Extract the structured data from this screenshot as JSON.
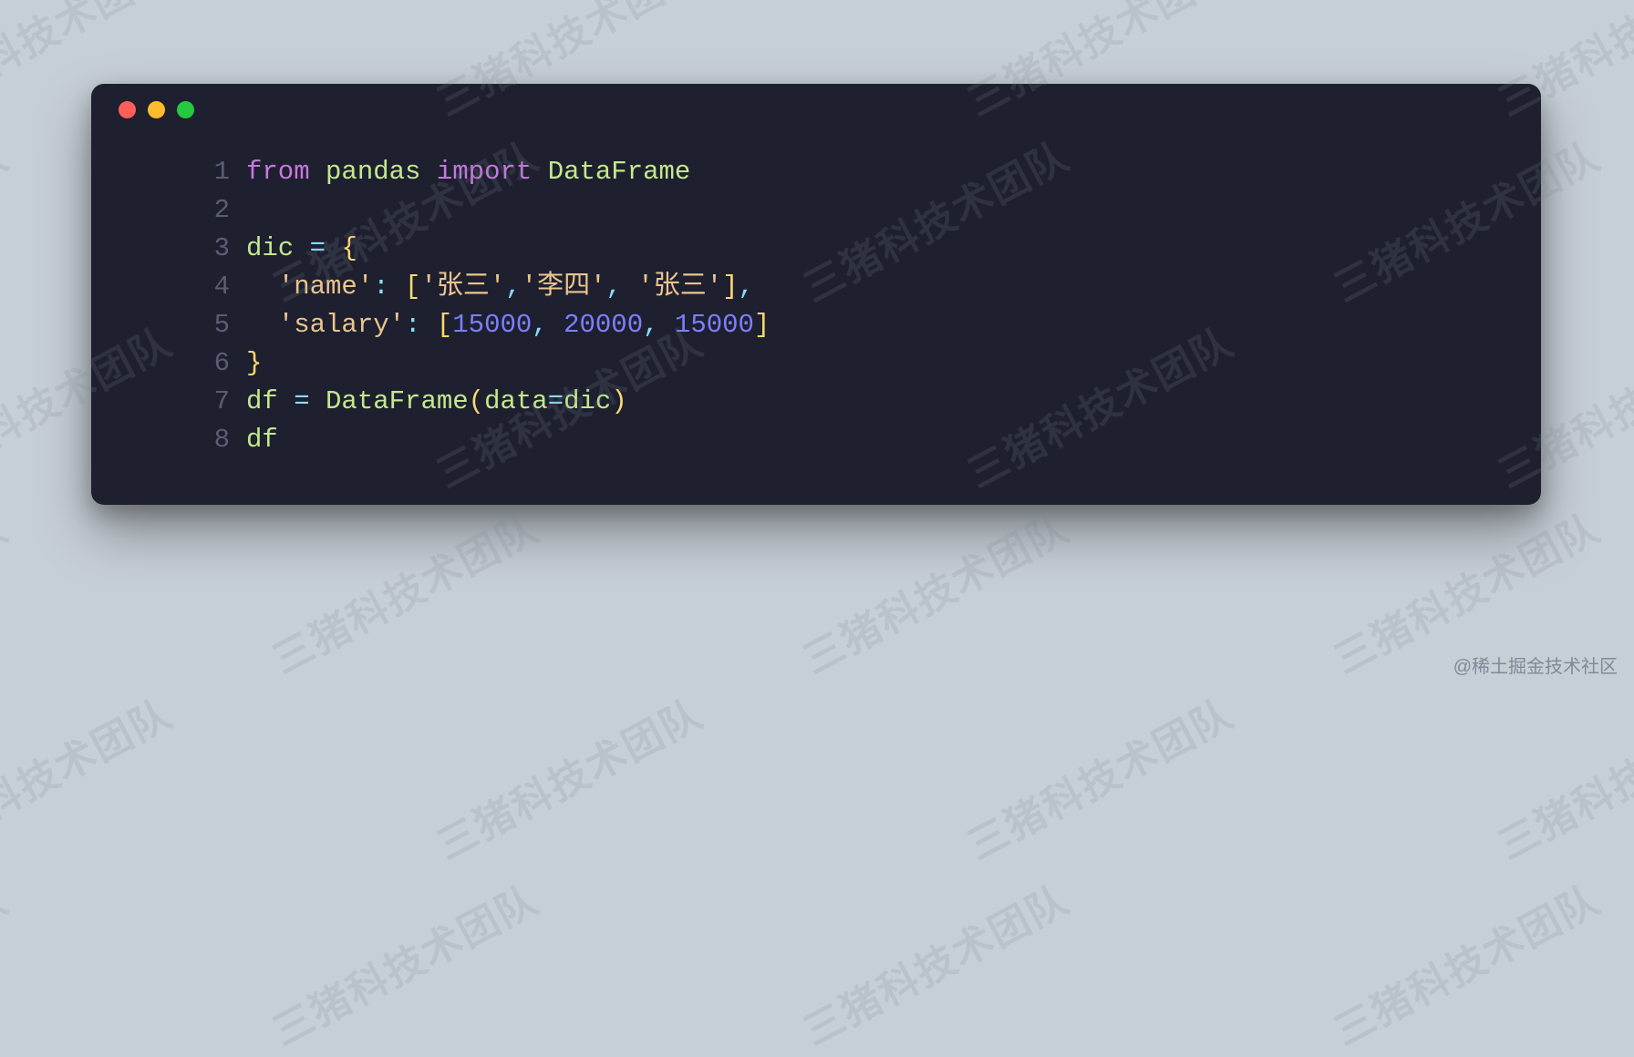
{
  "traffic_lights": [
    "red",
    "yellow",
    "green"
  ],
  "code": {
    "lines": [
      {
        "num": "1",
        "tokens": [
          {
            "cls": "tok-keyword",
            "text": "from"
          },
          {
            "cls": "tok-plain",
            "text": " "
          },
          {
            "cls": "tok-module",
            "text": "pandas"
          },
          {
            "cls": "tok-plain",
            "text": " "
          },
          {
            "cls": "tok-keyword",
            "text": "import"
          },
          {
            "cls": "tok-plain",
            "text": " "
          },
          {
            "cls": "tok-identifier",
            "text": "DataFrame"
          }
        ]
      },
      {
        "num": "2",
        "tokens": []
      },
      {
        "num": "3",
        "tokens": [
          {
            "cls": "tok-identifier",
            "text": "dic"
          },
          {
            "cls": "tok-plain",
            "text": " "
          },
          {
            "cls": "tok-operator",
            "text": "="
          },
          {
            "cls": "tok-plain",
            "text": " "
          },
          {
            "cls": "tok-bracket",
            "text": "{"
          }
        ]
      },
      {
        "num": "4",
        "tokens": [
          {
            "cls": "tok-plain",
            "text": "  "
          },
          {
            "cls": "tok-string",
            "text": "'name'"
          },
          {
            "cls": "tok-punct",
            "text": ":"
          },
          {
            "cls": "tok-plain",
            "text": " "
          },
          {
            "cls": "tok-bracket",
            "text": "["
          },
          {
            "cls": "tok-string",
            "text": "'张三'"
          },
          {
            "cls": "tok-punct",
            "text": ","
          },
          {
            "cls": "tok-string",
            "text": "'李四'"
          },
          {
            "cls": "tok-punct",
            "text": ","
          },
          {
            "cls": "tok-plain",
            "text": " "
          },
          {
            "cls": "tok-string",
            "text": "'张三'"
          },
          {
            "cls": "tok-bracket",
            "text": "]"
          },
          {
            "cls": "tok-punct",
            "text": ","
          }
        ]
      },
      {
        "num": "5",
        "tokens": [
          {
            "cls": "tok-plain",
            "text": "  "
          },
          {
            "cls": "tok-string",
            "text": "'salary'"
          },
          {
            "cls": "tok-punct",
            "text": ":"
          },
          {
            "cls": "tok-plain",
            "text": " "
          },
          {
            "cls": "tok-bracket",
            "text": "["
          },
          {
            "cls": "tok-number",
            "text": "15000"
          },
          {
            "cls": "tok-punct",
            "text": ","
          },
          {
            "cls": "tok-plain",
            "text": " "
          },
          {
            "cls": "tok-number",
            "text": "20000"
          },
          {
            "cls": "tok-punct",
            "text": ","
          },
          {
            "cls": "tok-plain",
            "text": " "
          },
          {
            "cls": "tok-number",
            "text": "15000"
          },
          {
            "cls": "tok-bracket",
            "text": "]"
          }
        ]
      },
      {
        "num": "6",
        "tokens": [
          {
            "cls": "tok-bracket",
            "text": "}"
          }
        ]
      },
      {
        "num": "7",
        "tokens": [
          {
            "cls": "tok-identifier",
            "text": "df"
          },
          {
            "cls": "tok-plain",
            "text": " "
          },
          {
            "cls": "tok-operator",
            "text": "="
          },
          {
            "cls": "tok-plain",
            "text": " "
          },
          {
            "cls": "tok-func",
            "text": "DataFrame"
          },
          {
            "cls": "tok-bracket",
            "text": "("
          },
          {
            "cls": "tok-param",
            "text": "data"
          },
          {
            "cls": "tok-operator",
            "text": "="
          },
          {
            "cls": "tok-identifier",
            "text": "dic"
          },
          {
            "cls": "tok-bracket",
            "text": ")"
          }
        ]
      },
      {
        "num": "8",
        "tokens": [
          {
            "cls": "tok-identifier",
            "text": "df"
          }
        ]
      }
    ]
  },
  "watermark_text": "三猪科技术团队",
  "attribution": "@稀土掘金技术社区"
}
